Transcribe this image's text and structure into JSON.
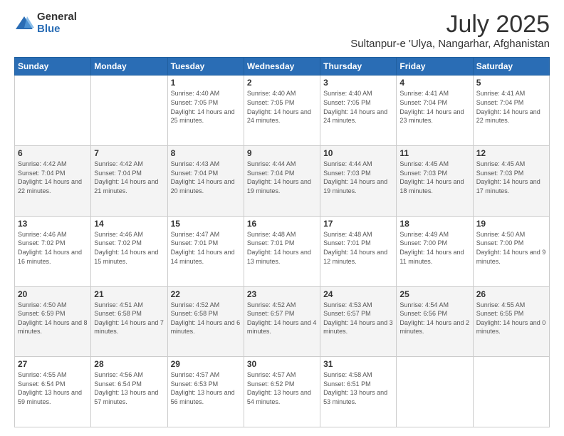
{
  "logo": {
    "general": "General",
    "blue": "Blue"
  },
  "title": "July 2025",
  "subtitle": "Sultanpur-e 'Ulya, Nangarhar, Afghanistan",
  "days_of_week": [
    "Sunday",
    "Monday",
    "Tuesday",
    "Wednesday",
    "Thursday",
    "Friday",
    "Saturday"
  ],
  "weeks": [
    [
      {
        "day": "",
        "detail": ""
      },
      {
        "day": "",
        "detail": ""
      },
      {
        "day": "1",
        "detail": "Sunrise: 4:40 AM\nSunset: 7:05 PM\nDaylight: 14 hours and 25 minutes."
      },
      {
        "day": "2",
        "detail": "Sunrise: 4:40 AM\nSunset: 7:05 PM\nDaylight: 14 hours and 24 minutes."
      },
      {
        "day": "3",
        "detail": "Sunrise: 4:40 AM\nSunset: 7:05 PM\nDaylight: 14 hours and 24 minutes."
      },
      {
        "day": "4",
        "detail": "Sunrise: 4:41 AM\nSunset: 7:04 PM\nDaylight: 14 hours and 23 minutes."
      },
      {
        "day": "5",
        "detail": "Sunrise: 4:41 AM\nSunset: 7:04 PM\nDaylight: 14 hours and 22 minutes."
      }
    ],
    [
      {
        "day": "6",
        "detail": "Sunrise: 4:42 AM\nSunset: 7:04 PM\nDaylight: 14 hours and 22 minutes."
      },
      {
        "day": "7",
        "detail": "Sunrise: 4:42 AM\nSunset: 7:04 PM\nDaylight: 14 hours and 21 minutes."
      },
      {
        "day": "8",
        "detail": "Sunrise: 4:43 AM\nSunset: 7:04 PM\nDaylight: 14 hours and 20 minutes."
      },
      {
        "day": "9",
        "detail": "Sunrise: 4:44 AM\nSunset: 7:04 PM\nDaylight: 14 hours and 19 minutes."
      },
      {
        "day": "10",
        "detail": "Sunrise: 4:44 AM\nSunset: 7:03 PM\nDaylight: 14 hours and 19 minutes."
      },
      {
        "day": "11",
        "detail": "Sunrise: 4:45 AM\nSunset: 7:03 PM\nDaylight: 14 hours and 18 minutes."
      },
      {
        "day": "12",
        "detail": "Sunrise: 4:45 AM\nSunset: 7:03 PM\nDaylight: 14 hours and 17 minutes."
      }
    ],
    [
      {
        "day": "13",
        "detail": "Sunrise: 4:46 AM\nSunset: 7:02 PM\nDaylight: 14 hours and 16 minutes."
      },
      {
        "day": "14",
        "detail": "Sunrise: 4:46 AM\nSunset: 7:02 PM\nDaylight: 14 hours and 15 minutes."
      },
      {
        "day": "15",
        "detail": "Sunrise: 4:47 AM\nSunset: 7:01 PM\nDaylight: 14 hours and 14 minutes."
      },
      {
        "day": "16",
        "detail": "Sunrise: 4:48 AM\nSunset: 7:01 PM\nDaylight: 14 hours and 13 minutes."
      },
      {
        "day": "17",
        "detail": "Sunrise: 4:48 AM\nSunset: 7:01 PM\nDaylight: 14 hours and 12 minutes."
      },
      {
        "day": "18",
        "detail": "Sunrise: 4:49 AM\nSunset: 7:00 PM\nDaylight: 14 hours and 11 minutes."
      },
      {
        "day": "19",
        "detail": "Sunrise: 4:50 AM\nSunset: 7:00 PM\nDaylight: 14 hours and 9 minutes."
      }
    ],
    [
      {
        "day": "20",
        "detail": "Sunrise: 4:50 AM\nSunset: 6:59 PM\nDaylight: 14 hours and 8 minutes."
      },
      {
        "day": "21",
        "detail": "Sunrise: 4:51 AM\nSunset: 6:58 PM\nDaylight: 14 hours and 7 minutes."
      },
      {
        "day": "22",
        "detail": "Sunrise: 4:52 AM\nSunset: 6:58 PM\nDaylight: 14 hours and 6 minutes."
      },
      {
        "day": "23",
        "detail": "Sunrise: 4:52 AM\nSunset: 6:57 PM\nDaylight: 14 hours and 4 minutes."
      },
      {
        "day": "24",
        "detail": "Sunrise: 4:53 AM\nSunset: 6:57 PM\nDaylight: 14 hours and 3 minutes."
      },
      {
        "day": "25",
        "detail": "Sunrise: 4:54 AM\nSunset: 6:56 PM\nDaylight: 14 hours and 2 minutes."
      },
      {
        "day": "26",
        "detail": "Sunrise: 4:55 AM\nSunset: 6:55 PM\nDaylight: 14 hours and 0 minutes."
      }
    ],
    [
      {
        "day": "27",
        "detail": "Sunrise: 4:55 AM\nSunset: 6:54 PM\nDaylight: 13 hours and 59 minutes."
      },
      {
        "day": "28",
        "detail": "Sunrise: 4:56 AM\nSunset: 6:54 PM\nDaylight: 13 hours and 57 minutes."
      },
      {
        "day": "29",
        "detail": "Sunrise: 4:57 AM\nSunset: 6:53 PM\nDaylight: 13 hours and 56 minutes."
      },
      {
        "day": "30",
        "detail": "Sunrise: 4:57 AM\nSunset: 6:52 PM\nDaylight: 13 hours and 54 minutes."
      },
      {
        "day": "31",
        "detail": "Sunrise: 4:58 AM\nSunset: 6:51 PM\nDaylight: 13 hours and 53 minutes."
      },
      {
        "day": "",
        "detail": ""
      },
      {
        "day": "",
        "detail": ""
      }
    ]
  ]
}
